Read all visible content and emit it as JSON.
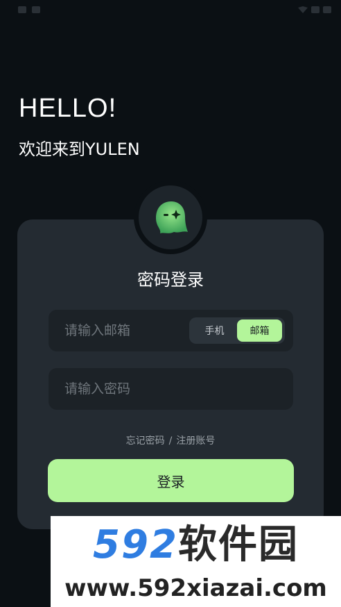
{
  "status_bar": {
    "left_text": "",
    "right_text": ""
  },
  "greeting": {
    "title": "HELLO!",
    "subtitle": "欢迎来到YULEN"
  },
  "avatar": {
    "icon": "ghost-mascot-icon",
    "color": "#7fe07a"
  },
  "login": {
    "title": "密码登录",
    "email_placeholder": "请输入邮箱",
    "password_placeholder": "请输入密码",
    "toggle": {
      "phone_label": "手机",
      "email_label": "邮箱",
      "selected": "邮箱"
    },
    "forgot_link": "忘记密码",
    "separator": "/",
    "register_link": "注册账号",
    "submit_label": "登录"
  },
  "colors": {
    "accent": "#b3f59a",
    "card": "#242b32",
    "background": "#0b1014"
  },
  "watermark": {
    "top_number": "592",
    "top_text": "软件园",
    "url": "www.592xiazai.com"
  }
}
